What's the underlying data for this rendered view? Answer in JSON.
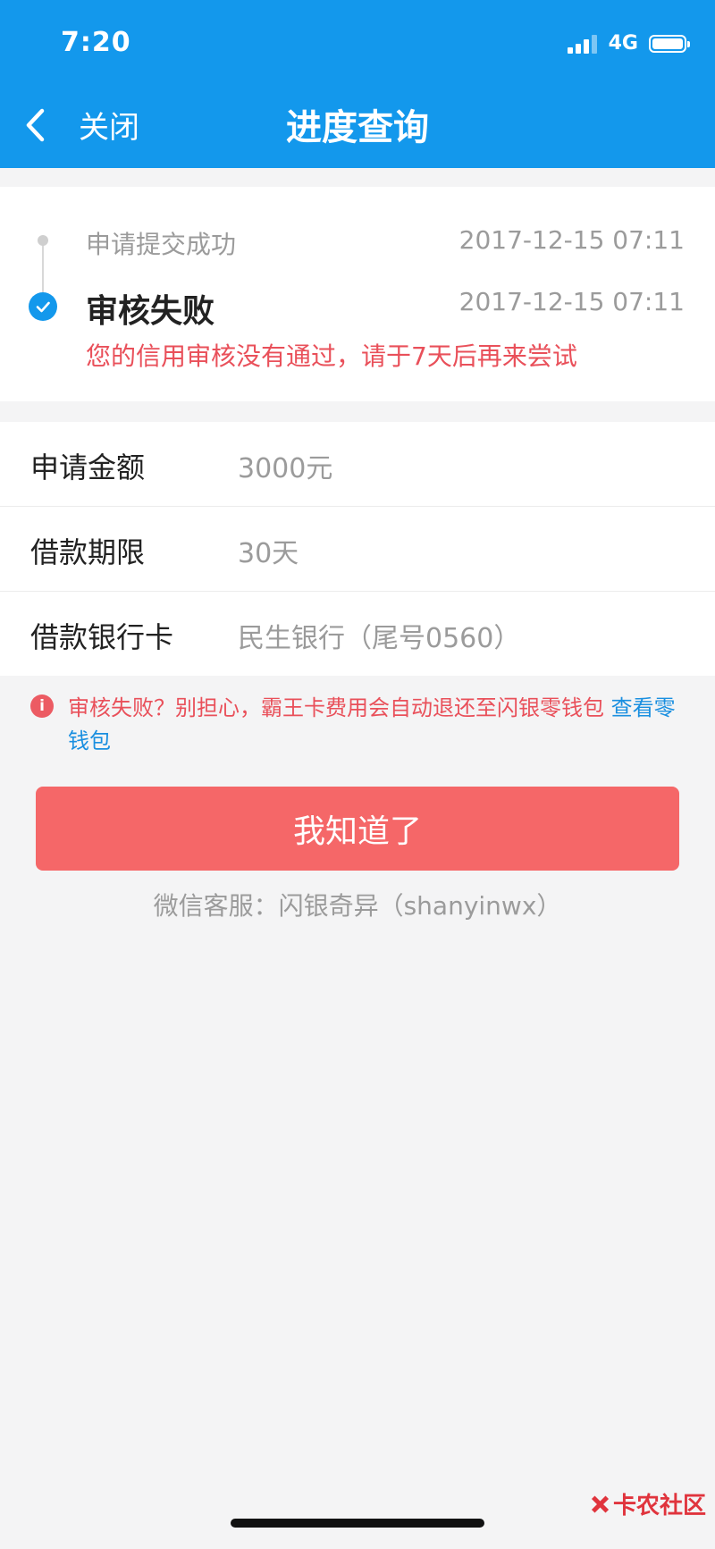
{
  "status_bar": {
    "time": "7:20",
    "network": "4G",
    "signal_icon": "signal-icon",
    "battery_icon": "battery-icon"
  },
  "nav": {
    "back_icon": "chevron-left-icon",
    "back_label": "关闭",
    "title": "进度查询"
  },
  "timeline": {
    "steps": [
      {
        "label": "申请提交成功",
        "time": "2017-12-15 07:11",
        "state": "done"
      },
      {
        "label": "审核失败",
        "time": "2017-12-15 07:11",
        "state": "current",
        "description": "您的信用审核没有通过，请于7天后再来尝试"
      }
    ]
  },
  "details": [
    {
      "label": "申请金额",
      "value": "3000元"
    },
    {
      "label": "借款期限",
      "value": "30天"
    },
    {
      "label": "借款银行卡",
      "value": "民生银行（尾号0560）"
    }
  ],
  "notice": {
    "icon": "info-icon",
    "icon_glyph": "i",
    "text": "审核失败？别担心，霸王卡费用会自动退还至闪银零钱包",
    "link_text": "查看零钱包"
  },
  "actions": {
    "confirm_label": "我知道了"
  },
  "service": {
    "text": "微信客服：闪银奇异（shanyinwx）"
  },
  "watermark": {
    "text": "卡农社区"
  },
  "colors": {
    "header_bg": "#1398ec",
    "button_bg": "#f56768",
    "error_text": "#e9505a",
    "link": "#1a8fe0"
  }
}
